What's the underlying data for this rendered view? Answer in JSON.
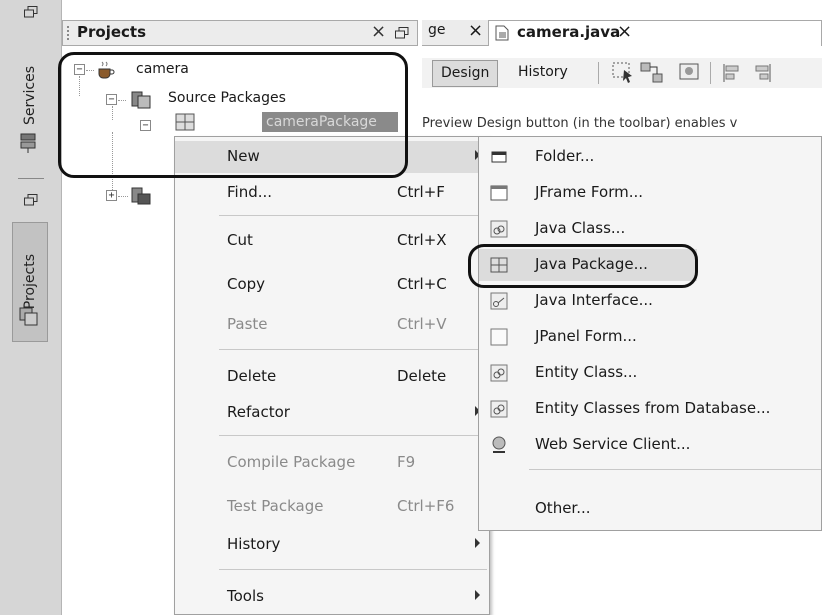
{
  "side_strip": {
    "tabs": [
      {
        "label": "Services",
        "icon": "services-icon"
      },
      {
        "label": "Projects",
        "icon": "projects-icon"
      }
    ]
  },
  "projects_panel": {
    "title": "Projects",
    "close": "×",
    "tree": {
      "root": {
        "label": "camera",
        "icon": "coffee-cup-icon",
        "expander": "−"
      },
      "source_packages": {
        "label": "Source Packages",
        "expander": "−"
      },
      "selected_package": {
        "label": "cameraPackage",
        "expander": "−"
      },
      "libraries": {
        "expander": "+"
      }
    }
  },
  "editor": {
    "tabs": [
      {
        "label": "ge",
        "close": "×"
      },
      {
        "label": "camera.java",
        "close": "×",
        "active": true
      }
    ],
    "toolbar": {
      "design": "Design",
      "history": "History"
    },
    "hint_text": "Preview Design button (in the toolbar) enables v"
  },
  "context_menu": {
    "items": [
      {
        "label": "New",
        "accel": "",
        "submenu": true,
        "disabled": false,
        "hover": true
      },
      {
        "label": "Find...",
        "accel": "Ctrl+F",
        "submenu": false,
        "disabled": false
      },
      {
        "label": "Cut",
        "accel": "Ctrl+X",
        "submenu": false,
        "disabled": false
      },
      {
        "label": "Copy",
        "accel": "Ctrl+C",
        "submenu": false,
        "disabled": false
      },
      {
        "label": "Paste",
        "accel": "Ctrl+V",
        "submenu": false,
        "disabled": true
      },
      {
        "label": "Delete",
        "accel": "Delete",
        "submenu": false,
        "disabled": false
      },
      {
        "label": "Refactor",
        "accel": "",
        "submenu": true,
        "disabled": false
      },
      {
        "label": "Compile Package",
        "accel": "F9",
        "submenu": false,
        "disabled": true
      },
      {
        "label": "Test Package",
        "accel": "Ctrl+F6",
        "submenu": false,
        "disabled": true
      },
      {
        "label": "History",
        "accel": "",
        "submenu": true,
        "disabled": false
      },
      {
        "label": "Tools",
        "accel": "",
        "submenu": true,
        "disabled": false
      }
    ]
  },
  "submenu": {
    "items": [
      {
        "label": "Folder...",
        "icon": "folder-icon"
      },
      {
        "label": "JFrame Form...",
        "icon": "jframe-form-icon"
      },
      {
        "label": "Java Class...",
        "icon": "java-class-icon"
      },
      {
        "label": "Java Package...",
        "icon": "java-package-icon",
        "hover": true
      },
      {
        "label": "Java Interface...",
        "icon": "java-interface-icon"
      },
      {
        "label": "JPanel Form...",
        "icon": "jpanel-form-icon"
      },
      {
        "label": "Entity Class...",
        "icon": "entity-class-icon"
      },
      {
        "label": "Entity Classes from Database...",
        "icon": "entity-classes-db-icon"
      },
      {
        "label": "Web Service Client...",
        "icon": "web-service-client-icon"
      },
      {
        "label": "Other...",
        "icon": ""
      }
    ]
  },
  "colors": {
    "menu_bg": "#f5f5f5",
    "hover_bg": "#dcdcdc",
    "selected_node_bg": "#8a8a8a",
    "highlight_outline": "#111111"
  }
}
